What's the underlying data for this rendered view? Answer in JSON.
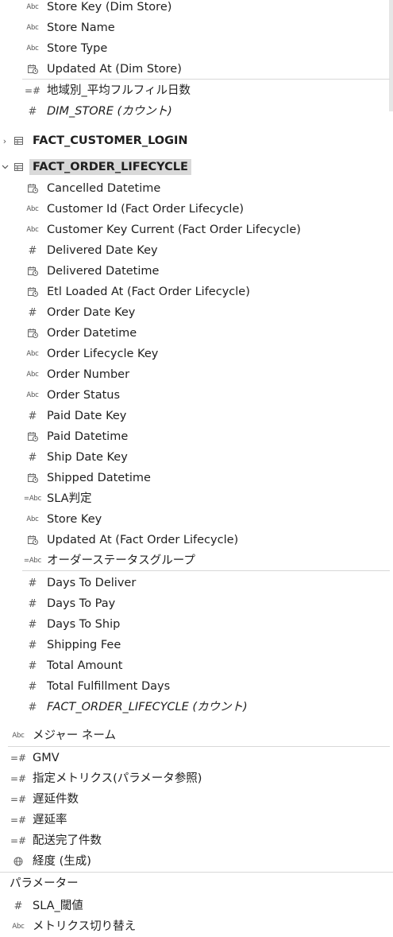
{
  "items": [
    {
      "icon": "abc-icon",
      "label": "Store Key (Dim Store)"
    },
    {
      "icon": "abc-icon",
      "label": "Store Name"
    },
    {
      "icon": "abc-icon",
      "label": "Store Type"
    },
    {
      "icon": "calendar-icon",
      "label": "Updated At (Dim Store)"
    },
    {
      "icon": "calc-hash-icon",
      "label": "地域別_平均フルフィル日数"
    },
    {
      "icon": "hash-icon",
      "label": "DIM_STORE (カウント)"
    }
  ],
  "tables": {
    "customer_login": "FACT_CUSTOMER_LOGIN",
    "order_lifecycle": "FACT_ORDER_LIFECYCLE"
  },
  "order_fields": [
    {
      "icon": "calendar-icon",
      "label": "Cancelled Datetime"
    },
    {
      "icon": "abc-icon",
      "label": "Customer Id (Fact Order Lifecycle)"
    },
    {
      "icon": "abc-icon",
      "label": "Customer Key Current (Fact Order Lifecycle)"
    },
    {
      "icon": "hash-icon",
      "label": "Delivered Date Key"
    },
    {
      "icon": "calendar-icon",
      "label": "Delivered Datetime"
    },
    {
      "icon": "calendar-icon",
      "label": "Etl Loaded At (Fact Order Lifecycle)"
    },
    {
      "icon": "hash-icon",
      "label": "Order Date Key"
    },
    {
      "icon": "calendar-icon",
      "label": "Order Datetime"
    },
    {
      "icon": "abc-icon",
      "label": "Order Lifecycle Key"
    },
    {
      "icon": "abc-icon",
      "label": "Order Number"
    },
    {
      "icon": "abc-icon",
      "label": "Order Status"
    },
    {
      "icon": "hash-icon",
      "label": "Paid Date Key"
    },
    {
      "icon": "calendar-icon",
      "label": "Paid Datetime"
    },
    {
      "icon": "hash-icon",
      "label": "Ship Date Key"
    },
    {
      "icon": "calendar-icon",
      "label": "Shipped Datetime"
    },
    {
      "icon": "calc-abc-icon",
      "label": "SLA判定"
    },
    {
      "icon": "abc-icon",
      "label": "Store Key"
    },
    {
      "icon": "calendar-icon",
      "label": "Updated At (Fact Order Lifecycle)"
    },
    {
      "icon": "calc-abc-icon",
      "label": "オーダーステータスグループ"
    }
  ],
  "order_measures": [
    {
      "icon": "hash-icon",
      "label": "Days To Deliver"
    },
    {
      "icon": "hash-icon",
      "label": "Days To Pay"
    },
    {
      "icon": "hash-icon",
      "label": "Days To Ship"
    },
    {
      "icon": "hash-icon",
      "label": "Shipping Fee"
    },
    {
      "icon": "hash-icon",
      "label": "Total Amount"
    },
    {
      "icon": "hash-icon",
      "label": "Total Fulfillment Days"
    },
    {
      "icon": "hash-icon",
      "label": "FACT_ORDER_LIFECYCLE (カウント)"
    }
  ],
  "measure_names": {
    "icon": "abc-icon",
    "label": "メジャー ネーム"
  },
  "global_measures": [
    {
      "icon": "calc-hash-icon",
      "label": "GMV"
    },
    {
      "icon": "calc-hash-icon",
      "label": "指定メトリクス(パラメータ参照)"
    },
    {
      "icon": "calc-hash-icon",
      "label": "遅延件数"
    },
    {
      "icon": "calc-hash-icon",
      "label": "遅延率"
    },
    {
      "icon": "calc-hash-icon",
      "label": "配送完了件数"
    },
    {
      "icon": "globe-icon",
      "label": "経度 (生成)"
    }
  ],
  "parameters": {
    "header": "パラメーター",
    "items": [
      {
        "icon": "hash-icon",
        "label": "SLA_閾値"
      },
      {
        "icon": "abc-icon",
        "label": "メトリクス切り替え"
      }
    ]
  },
  "glyphs": {
    "abc": "Abc",
    "calc_abc": "=Abc",
    "hash": "#",
    "calc_hash": "=#",
    "chevron_right": "›",
    "chevron_down": "⌄"
  }
}
